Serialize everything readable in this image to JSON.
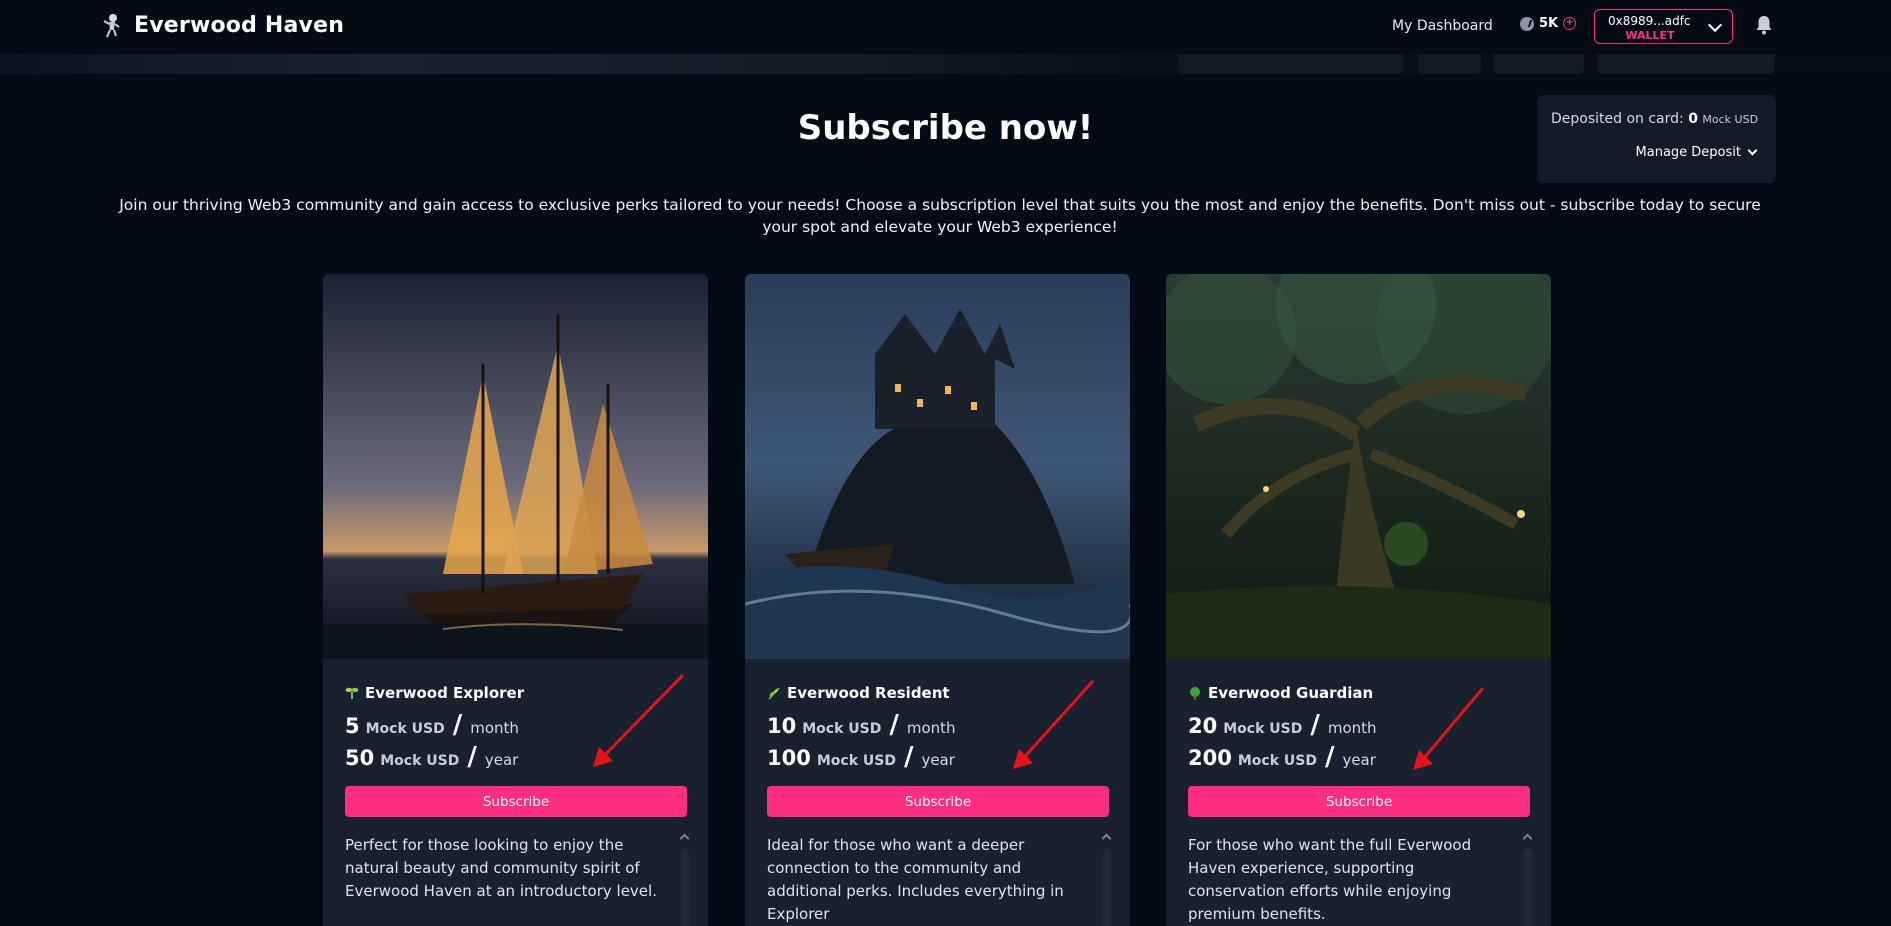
{
  "nav": {
    "brand": "Everwood Haven",
    "dashboard": "My Dashboard",
    "tokens": "5K",
    "wallet_address": "0x8989...adfc",
    "wallet_label": "WALLET"
  },
  "deposit": {
    "label": "Deposited on card:",
    "amount": "0",
    "unit": "Mock USD",
    "manage": "Manage Deposit"
  },
  "page": {
    "title": "Subscribe now!",
    "intro": "Join our thriving Web3 community and gain access to exclusive perks tailored to your needs! Choose a subscription level that suits you the most and enjoy the benefits. Don't miss out - subscribe today to secure your spot and elevate your Web3 experience!"
  },
  "tiers": [
    {
      "name": "Everwood Explorer",
      "icon": "seedling-icon",
      "monthly_price": "5",
      "yearly_price": "50",
      "unit": "Mock USD",
      "month": "month",
      "year": "year",
      "button": "Subscribe",
      "description": "Perfect for those looking to enjoy the natural beauty and community spirit of Everwood Haven at an introductory level."
    },
    {
      "name": "Everwood Resident",
      "icon": "herb-icon",
      "monthly_price": "10",
      "yearly_price": "100",
      "unit": "Mock USD",
      "month": "month",
      "year": "year",
      "button": "Subscribe",
      "description": "Ideal for those who want a deeper connection to the community and additional perks. Includes everything in Explorer"
    },
    {
      "name": "Everwood Guardian",
      "icon": "tree-icon",
      "monthly_price": "20",
      "yearly_price": "200",
      "unit": "Mock USD",
      "month": "month",
      "year": "year",
      "button": "Subscribe",
      "description": "For those who want the full Everwood Haven experience, supporting conservation efforts while enjoying premium benefits."
    }
  ],
  "colors": {
    "accent": "#ff2d7f",
    "background": "#050b14",
    "card": "#1a212e",
    "annotation_arrow": "#e8121b"
  }
}
